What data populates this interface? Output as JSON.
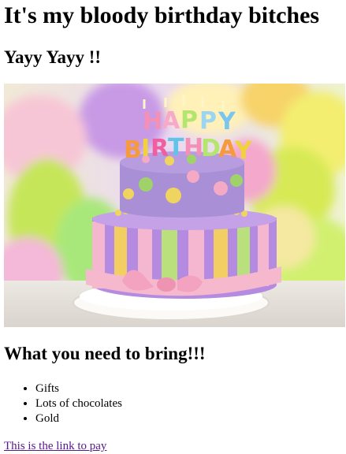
{
  "page": {
    "title": "It's my bloody birthday bitches",
    "subtitle": "Yayy Yayy !!",
    "bring_heading": "What you need to bring!!!",
    "bring_items": [
      "Gifts",
      "Lots of chocolates",
      "Gold"
    ],
    "pay_link": "This is the link to pay"
  },
  "image": {
    "topper_letters": [
      "H",
      "A",
      "P",
      "P",
      "Y",
      "B",
      "I",
      "R",
      "T",
      "H",
      "D",
      "A",
      "Y"
    ],
    "colors": {
      "cake_top": "#a98fd6",
      "cake_bottom": "#b48be0",
      "stripe_pink": "#f5b6cf",
      "stripe_yellow": "#f3cf63",
      "stripe_green": "#b9e07c",
      "ribbon": "#f6b8cc",
      "dot_yellow": "#f0d460",
      "dot_green": "#9fd36a",
      "dot_pink": "#f4a9c4",
      "plate": "#f4f1ec",
      "table": "#e6e2dc"
    }
  }
}
